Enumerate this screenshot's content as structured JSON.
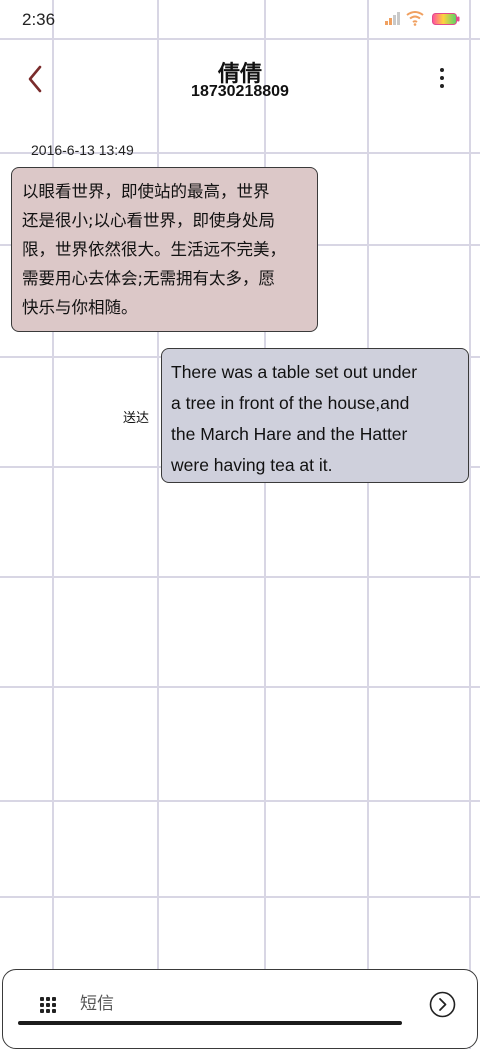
{
  "status_bar": {
    "time": "2:36",
    "signal_icon": "signal-icon",
    "wifi_icon": "wifi-icon",
    "battery_icon": "battery-icon"
  },
  "header": {
    "back_icon": "chevron-left-icon",
    "contact_name": "倩倩",
    "contact_number": "18730218809",
    "more_icon": "more-vertical-icon"
  },
  "messages": [
    {
      "direction": "incoming",
      "timestamp": "2016-6-13 13:49",
      "lines": [
        "以眼看世界，即使站的最高，世界",
        "还是很小;以心看世界，即使身处局",
        "限，世界依然很大。生活远不完美，",
        "需要用心去体会;无需拥有太多，愿",
        "快乐与你相随。"
      ]
    },
    {
      "direction": "outgoing",
      "status": "送达",
      "lines": [
        "There was a table set out under",
        "a tree in front of the house,and",
        "the March Hare and the Hatter",
        "were having tea at it."
      ]
    }
  ],
  "composer": {
    "apps_icon": "apps-grid-icon",
    "placeholder": "短信",
    "value": "",
    "send_icon": "send-arrow-icon"
  },
  "colors": {
    "incoming_bubble": "#dcc8c8",
    "outgoing_bubble": "#cfd0dc",
    "back_arrow": "#7a2c2c",
    "grid_lines": "#d8d6e4"
  }
}
